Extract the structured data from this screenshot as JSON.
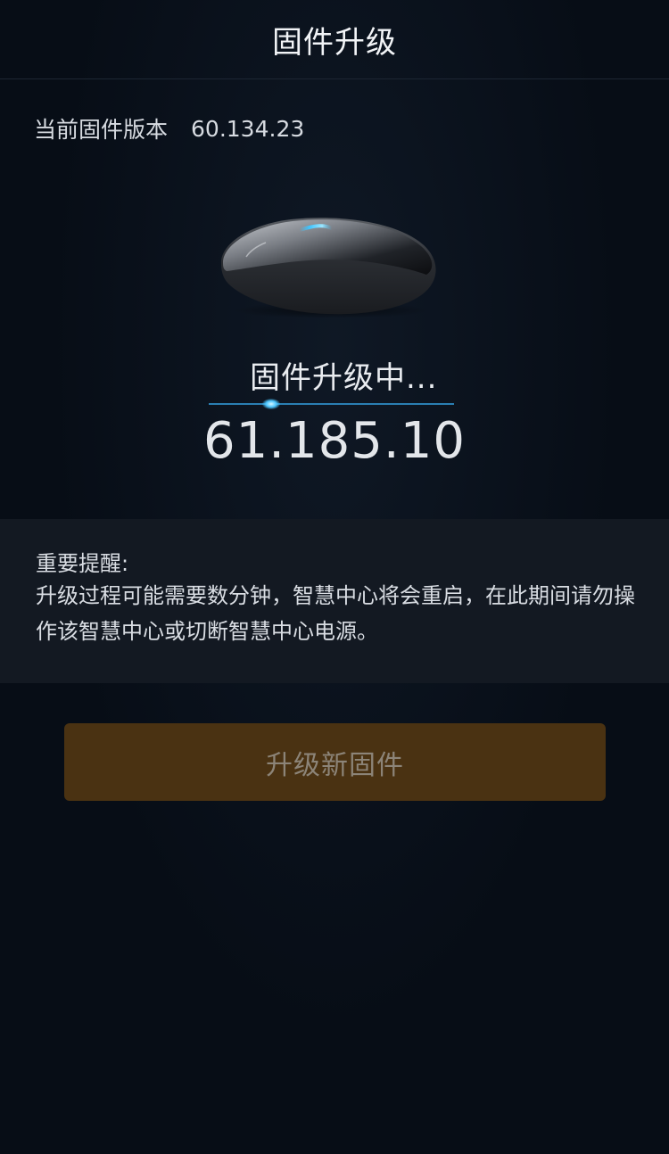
{
  "header": {
    "title": "固件升级"
  },
  "current_firmware": {
    "label": "当前固件版本",
    "version": "60.134.23"
  },
  "device": {
    "icon": "smart-hub-device-image",
    "accent_color": "#3fc4ff"
  },
  "upgrade_progress": {
    "status_text": "固件升级中...",
    "progress_bar_color": "#2a7fb3",
    "target_version": "61.185.10"
  },
  "notice": {
    "title": "重要提醒:",
    "body": "升级过程可能需要数分钟，智慧中心将会重启，在此期间请勿操作该智慧中心或切断智慧中心电源。"
  },
  "actions": {
    "upgrade_button_label": "升级新固件",
    "upgrade_button_color": "#4a3212"
  }
}
